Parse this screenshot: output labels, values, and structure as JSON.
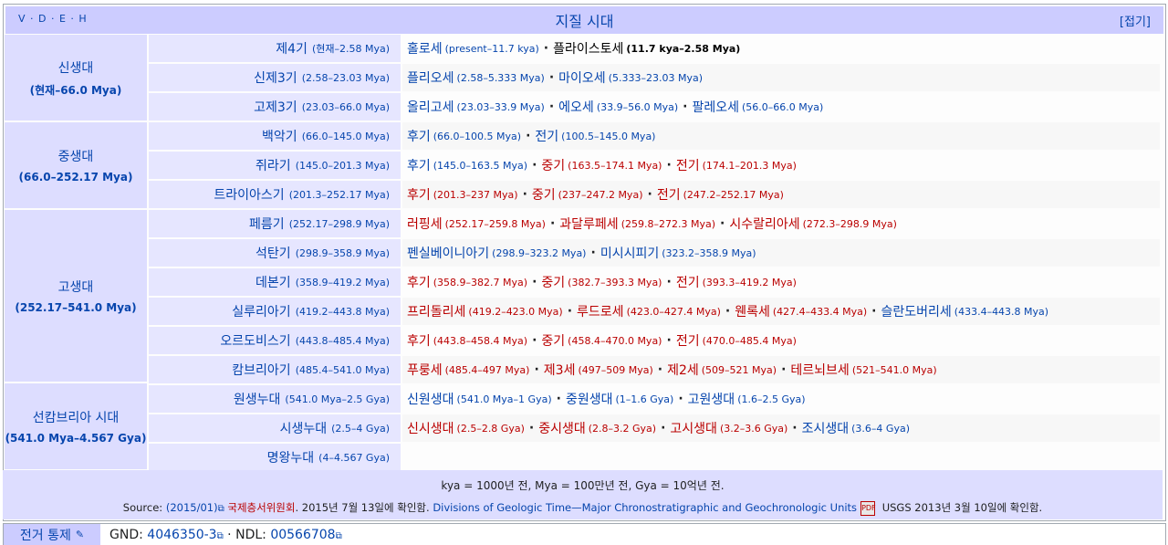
{
  "navbox": {
    "vde": "V · D · E · H",
    "title": "지질 시대",
    "hide": "[접기]"
  },
  "eras": [
    {
      "name": "신생대",
      "range": "(현재–66.0 Mya)"
    },
    {
      "name": "중생대",
      "range": "(66.0–252.17 Mya)"
    },
    {
      "name": "고생대",
      "range": "(252.17–541.0 Mya)"
    },
    {
      "name": "선캄브리아 시대",
      "range": "(541.0 Mya–4.567 Gya)"
    }
  ],
  "periods": [
    {
      "name": "제4기",
      "range": "(현재–2.58 Mya)",
      "items": [
        {
          "t": "홀로세",
          "r": "(present–11.7 kya)",
          "c": "blue"
        },
        {
          "t": "플라이스토세",
          "r": "(11.7 kya–2.58 Mya)",
          "c": "black"
        }
      ]
    },
    {
      "name": "신제3기",
      "range": "(2.58–23.03 Mya)",
      "items": [
        {
          "t": "플리오세",
          "r": "(2.58–5.333 Mya)",
          "c": "blue"
        },
        {
          "t": "마이오세",
          "r": "(5.333–23.03 Mya)",
          "c": "blue"
        }
      ]
    },
    {
      "name": "고제3기",
      "range": "(23.03–66.0 Mya)",
      "items": [
        {
          "t": "올리고세",
          "r": "(23.03–33.9 Mya)",
          "c": "blue"
        },
        {
          "t": "에오세",
          "r": "(33.9–56.0 Mya)",
          "c": "blue"
        },
        {
          "t": "팔레오세",
          "r": "(56.0–66.0 Mya)",
          "c": "blue"
        }
      ]
    },
    {
      "name": "백악기",
      "range": "(66.0–145.0 Mya)",
      "items": [
        {
          "t": "후기",
          "r": "(66.0–100.5 Mya)",
          "c": "blue"
        },
        {
          "t": "전기",
          "r": "(100.5–145.0 Mya)",
          "c": "blue"
        }
      ]
    },
    {
      "name": "쥐라기",
      "range": "(145.0–201.3 Mya)",
      "items": [
        {
          "t": "후기",
          "r": "(145.0–163.5 Mya)",
          "c": "blue"
        },
        {
          "t": "중기",
          "r": "(163.5–174.1 Mya)",
          "c": "red"
        },
        {
          "t": "전기",
          "r": "(174.1–201.3 Mya)",
          "c": "red"
        }
      ]
    },
    {
      "name": "트라이아스기",
      "range": "(201.3–252.17 Mya)",
      "items": [
        {
          "t": "후기",
          "r": "(201.3–237 Mya)",
          "c": "red"
        },
        {
          "t": "중기",
          "r": "(237–247.2 Mya)",
          "c": "red"
        },
        {
          "t": "전기",
          "r": "(247.2–252.17 Mya)",
          "c": "red"
        }
      ]
    },
    {
      "name": "페름기",
      "range": "(252.17–298.9 Mya)",
      "items": [
        {
          "t": "러핑세",
          "r": "(252.17–259.8 Mya)",
          "c": "red"
        },
        {
          "t": "과달루페세",
          "r": "(259.8–272.3 Mya)",
          "c": "red"
        },
        {
          "t": "시수랄리아세",
          "r": "(272.3–298.9 Mya)",
          "c": "red"
        }
      ]
    },
    {
      "name": "석탄기",
      "range": "(298.9–358.9 Mya)",
      "items": [
        {
          "t": "펜실베이니아기",
          "r": "(298.9–323.2 Mya)",
          "c": "blue"
        },
        {
          "t": "미시시피기",
          "r": "(323.2–358.9 Mya)",
          "c": "blue"
        }
      ]
    },
    {
      "name": "데본기",
      "range": "(358.9–419.2 Mya)",
      "items": [
        {
          "t": "후기",
          "r": "(358.9–382.7 Mya)",
          "c": "red"
        },
        {
          "t": "중기",
          "r": "(382.7–393.3 Mya)",
          "c": "red"
        },
        {
          "t": "전기",
          "r": "(393.3–419.2 Mya)",
          "c": "red"
        }
      ]
    },
    {
      "name": "실루리아기",
      "range": "(419.2–443.8 Mya)",
      "items": [
        {
          "t": "프리돌리세",
          "r": "(419.2–423.0 Mya)",
          "c": "red"
        },
        {
          "t": "루드로세",
          "r": "(423.0–427.4 Mya)",
          "c": "red"
        },
        {
          "t": "웬록세",
          "r": "(427.4–433.4 Mya)",
          "c": "red"
        },
        {
          "t": "슬란도버리세",
          "r": "(433.4–443.8 Mya)",
          "c": "blue"
        }
      ]
    },
    {
      "name": "오르도비스기",
      "range": "(443.8–485.4 Mya)",
      "items": [
        {
          "t": "후기",
          "r": "(443.8–458.4 Mya)",
          "c": "red"
        },
        {
          "t": "중기",
          "r": "(458.4–470.0 Mya)",
          "c": "red"
        },
        {
          "t": "전기",
          "r": "(470.0–485.4 Mya)",
          "c": "red"
        }
      ]
    },
    {
      "name": "캄브리아기",
      "range": "(485.4–541.0 Mya)",
      "items": [
        {
          "t": "푸룽세",
          "r": "(485.4–497 Mya)",
          "c": "red"
        },
        {
          "t": "제3세",
          "r": "(497–509 Mya)",
          "c": "red"
        },
        {
          "t": "제2세",
          "r": "(509–521 Mya)",
          "c": "red"
        },
        {
          "t": "테르뇌브세",
          "r": "(521–541.0 Mya)",
          "c": "red"
        }
      ]
    },
    {
      "name": "원생누대",
      "range": "(541.0 Mya–2.5 Gya)",
      "items": [
        {
          "t": "신원생대",
          "r": "(541.0 Mya–1 Gya)",
          "c": "blue"
        },
        {
          "t": "중원생대",
          "r": "(1–1.6 Gya)",
          "c": "blue"
        },
        {
          "t": "고원생대",
          "r": "(1.6–2.5 Gya)",
          "c": "blue"
        }
      ]
    },
    {
      "name": "시생누대",
      "range": "(2.5–4 Gya)",
      "items": [
        {
          "t": "신시생대",
          "r": "(2.5–2.8 Gya)",
          "c": "red"
        },
        {
          "t": "중시생대",
          "r": "(2.8–3.2 Gya)",
          "c": "red"
        },
        {
          "t": "고시생대",
          "r": "(3.2–3.6 Gya)",
          "c": "red"
        },
        {
          "t": "조시생대",
          "r": "(3.6–4 Gya)",
          "c": "blue"
        }
      ]
    },
    {
      "name": "명왕누대",
      "range": "(4–4.567 Gya)",
      "items": []
    }
  ],
  "footer": {
    "units": "kya = 1000년 전, Mya = 100만년 전, Gya = 10억년 전.",
    "source_prefix": "Source: ",
    "source_date": "(2015/01)",
    "source_org": "국제층서위원회",
    "source_mid": ". 2015년 7월 13일에 확인함. ",
    "source_doc": "Divisions of Geologic Time—Major Chronostratigraphic and Geochronologic Units",
    "source_end": " USGS 2013년 3월 10일에 확인함."
  },
  "authority": {
    "header": "전거 통제",
    "gnd_label": "GND: ",
    "gnd_value": "4046350-3",
    "sep": " · ",
    "ndl_label": "NDL: ",
    "ndl_value": "00566708"
  },
  "colors": {
    "blue": "#0645ad",
    "red": "#ba0000",
    "black": "#000000"
  }
}
